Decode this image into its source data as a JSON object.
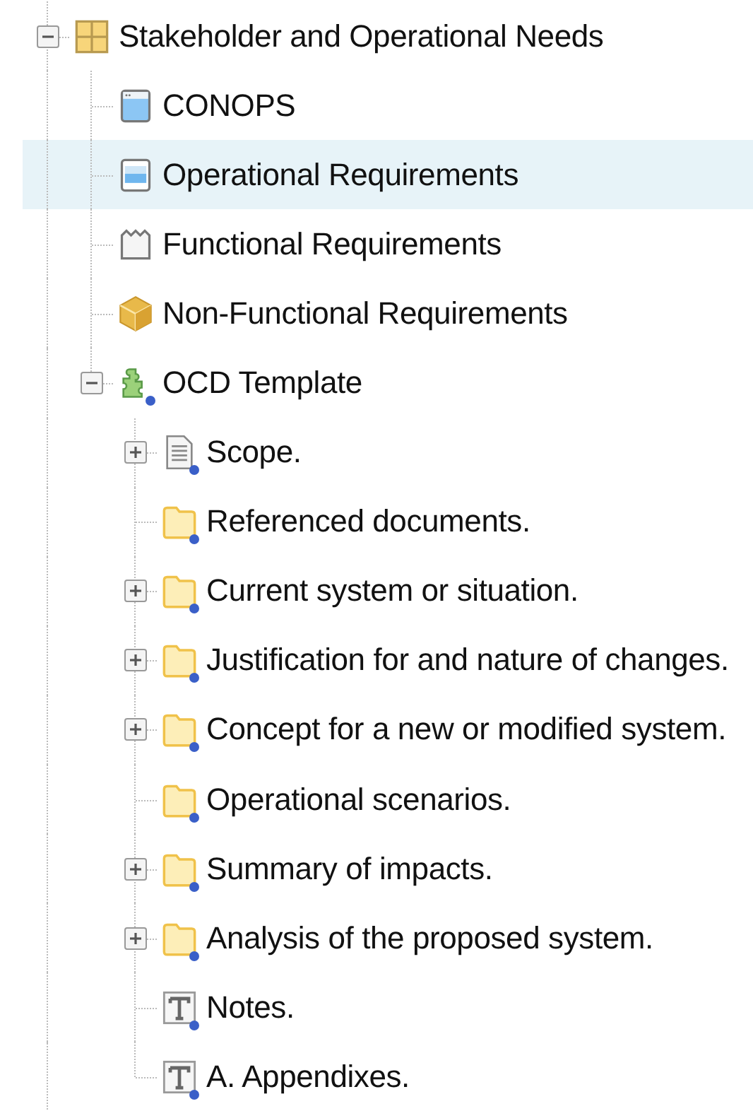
{
  "tree": [
    {
      "label": "Stakeholder and Operational Needs",
      "kind": "grid",
      "expanded": true,
      "selected": false,
      "badge": false,
      "children": [
        {
          "label": "CONOPS",
          "kind": "window",
          "selected": false,
          "badge": false
        },
        {
          "label": "Operational Requirements",
          "kind": "panel",
          "selected": true,
          "badge": false
        },
        {
          "label": "Functional Requirements",
          "kind": "tabbed",
          "selected": false,
          "badge": false
        },
        {
          "label": "Non-Functional Requirements",
          "kind": "cube",
          "selected": false,
          "badge": false
        },
        {
          "label": "OCD Template",
          "kind": "puzzle",
          "expanded": true,
          "selected": false,
          "badge": true,
          "children": [
            {
              "label": "Scope.",
              "kind": "document",
              "expanded": false,
              "selected": false,
              "badge": true
            },
            {
              "label": "Referenced documents.",
              "kind": "folder",
              "selected": false,
              "badge": true
            },
            {
              "label": "Current system or situation.",
              "kind": "folder",
              "expanded": false,
              "selected": false,
              "badge": true
            },
            {
              "label": "Justification for and nature of changes.",
              "kind": "folder",
              "expanded": false,
              "selected": false,
              "badge": true
            },
            {
              "label": "Concept for a new or modified system.",
              "kind": "folder",
              "expanded": false,
              "selected": false,
              "badge": true
            },
            {
              "label": "Operational scenarios.",
              "kind": "folder",
              "selected": false,
              "badge": true
            },
            {
              "label": "Summary of impacts.",
              "kind": "folder",
              "expanded": false,
              "selected": false,
              "badge": true
            },
            {
              "label": "Analysis of the proposed system.",
              "kind": "folder",
              "expanded": false,
              "selected": false,
              "badge": true
            },
            {
              "label": "Notes.",
              "kind": "text",
              "selected": false,
              "badge": true
            },
            {
              "label": "A. Appendixes.",
              "kind": "text",
              "selected": false,
              "badge": true
            }
          ]
        }
      ]
    }
  ]
}
